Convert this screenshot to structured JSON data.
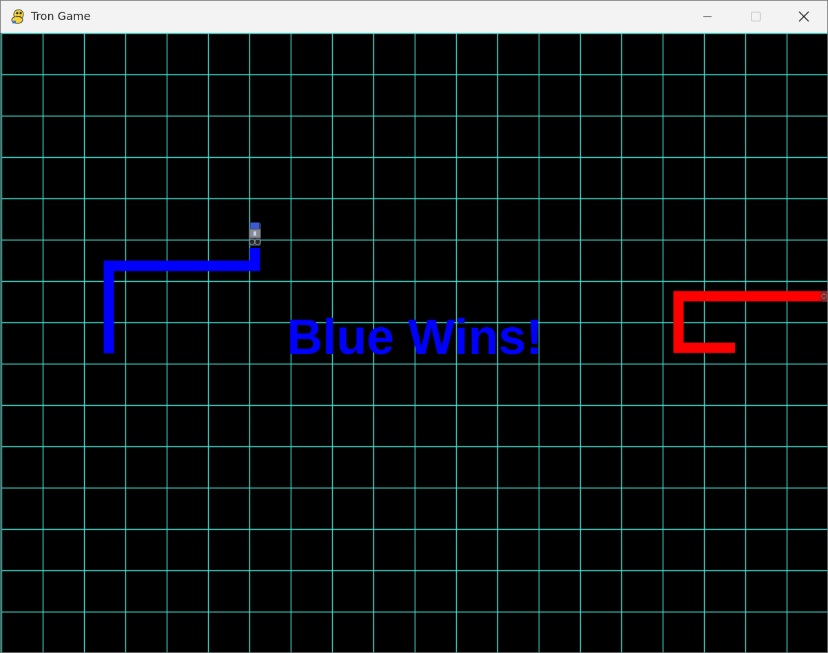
{
  "window": {
    "title": "Tron Game",
    "icon": "pygame-snake-icon"
  },
  "controls": {
    "minimize": "minimize-icon",
    "maximize": "maximize-icon",
    "close": "close-icon"
  },
  "game": {
    "background_color": "#000000",
    "grid_color": "#40e0d0",
    "grid_cell_size": 60,
    "result_message": "Blue Wins!",
    "result_color": "#0000ff",
    "players": [
      {
        "name": "blue",
        "trail_color": "#0000ff",
        "icon": "blue-bike-icon"
      },
      {
        "name": "red",
        "trail_color": "#ff0000",
        "icon": "red-bike-icon"
      }
    ]
  }
}
